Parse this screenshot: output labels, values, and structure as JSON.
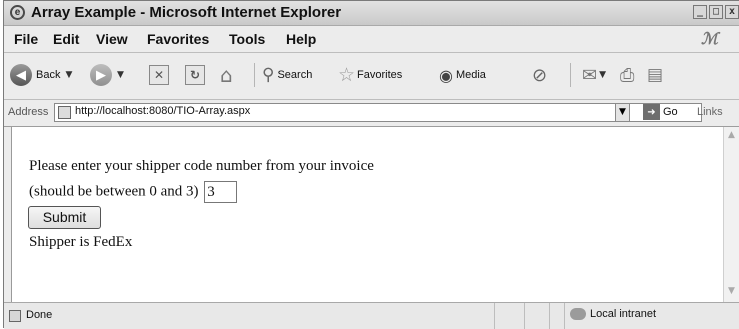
{
  "window": {
    "title": "Array Example - Microsoft Internet Explorer"
  },
  "menu": {
    "items": [
      "File",
      "Edit",
      "View",
      "Favorites",
      "Tools",
      "Help"
    ]
  },
  "toolbar": {
    "back_label": "Back",
    "search_label": "Search",
    "favorites_label": "Favorites",
    "media_label": "Media"
  },
  "address": {
    "label": "Address",
    "url": "http://localhost:8080/TIO-Array.aspx",
    "go_label": "Go",
    "links_label": "Links"
  },
  "page": {
    "prompt_line1": "Please enter your shipper code number from your invoice",
    "prompt_line2": "(should be between 0 and 3)",
    "input_value": "3",
    "submit_label": "Submit",
    "result_text": "Shipper is FedEx"
  },
  "status": {
    "text": "Done",
    "zone": "Local intranet"
  }
}
